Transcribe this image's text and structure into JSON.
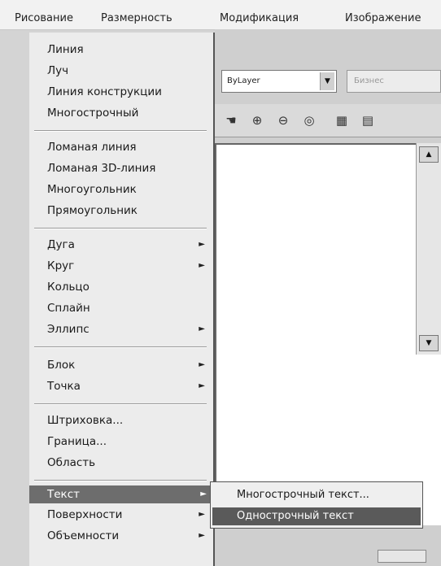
{
  "menubar": {
    "items": [
      "Рисование",
      "Размерность",
      "Модификация",
      "Изображение"
    ]
  },
  "toolbar": {
    "layer_combo_value": "ByLayer",
    "second_combo_value": "Бизнес"
  },
  "draw_menu": {
    "groups": [
      [
        "Линия",
        "Луч",
        "Линия конструкции",
        "Многострочный"
      ],
      [
        "Ломаная линия",
        "Ломаная 3D-линия",
        "Многоугольник",
        "Прямоугольник"
      ],
      [
        "Дуга",
        "Круг",
        "Кольцо",
        "Сплайн",
        "Эллипс"
      ],
      [
        "Блок",
        "Точка"
      ],
      [
        "Штриховка...",
        "Граница...",
        "Область"
      ],
      [
        "Текст",
        "Поверхности",
        "Объемности"
      ]
    ],
    "highlighted": "Текст"
  },
  "text_submenu": {
    "items": [
      "Многострочный текст...",
      "Однострочный текст"
    ],
    "highlighted": "Однострочный текст"
  }
}
